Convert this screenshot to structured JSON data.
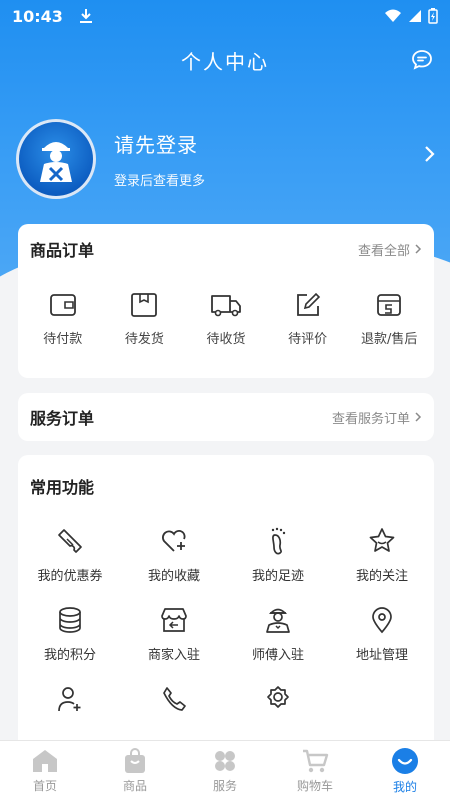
{
  "status": {
    "time": "10:43"
  },
  "header": {
    "title": "个人中心"
  },
  "profile": {
    "login_text": "请先登录",
    "sub_text": "登录后查看更多"
  },
  "goods_orders": {
    "title": "商品订单",
    "view_all": "查看全部",
    "items": [
      {
        "label": "待付款",
        "icon": "wallet-icon"
      },
      {
        "label": "待发货",
        "icon": "package-icon"
      },
      {
        "label": "待收货",
        "icon": "truck-icon"
      },
      {
        "label": "待评价",
        "icon": "edit-icon"
      },
      {
        "label": "退款/售后",
        "icon": "refund-icon"
      }
    ]
  },
  "service_orders": {
    "title": "服务订单",
    "view_all": "查看服务订单"
  },
  "common": {
    "title": "常用功能",
    "items": [
      {
        "label": "我的优惠券",
        "icon": "coupon-icon"
      },
      {
        "label": "我的收藏",
        "icon": "heart-plus-icon"
      },
      {
        "label": "我的足迹",
        "icon": "footprint-icon"
      },
      {
        "label": "我的关注",
        "icon": "star-icon"
      },
      {
        "label": "我的积分",
        "icon": "coins-icon"
      },
      {
        "label": "商家入驻",
        "icon": "store-icon"
      },
      {
        "label": "师傅入驻",
        "icon": "worker-icon"
      },
      {
        "label": "地址管理",
        "icon": "location-icon"
      },
      {
        "label": "",
        "icon": "add-user-icon"
      },
      {
        "label": "",
        "icon": "phone-icon"
      },
      {
        "label": "",
        "icon": "settings-icon"
      }
    ]
  },
  "tabbar": {
    "items": [
      {
        "label": "首页",
        "icon": "home-icon"
      },
      {
        "label": "商品",
        "icon": "bag-icon"
      },
      {
        "label": "服务",
        "icon": "clover-icon"
      },
      {
        "label": "购物车",
        "icon": "cart-icon"
      },
      {
        "label": "我的",
        "icon": "smile-icon",
        "active": true
      }
    ]
  },
  "colors": {
    "primary": "#1b7fe6",
    "background": "#f3f4f6"
  }
}
